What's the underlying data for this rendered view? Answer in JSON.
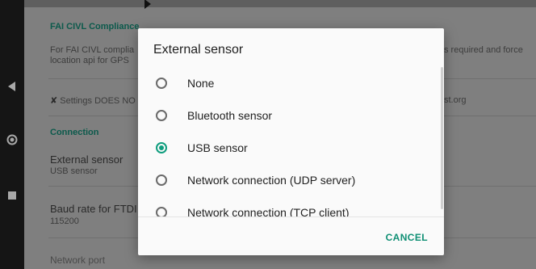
{
  "background": {
    "sections": [
      {
        "header": "FAI CIVL Compliance",
        "desc_left": "For FAI CIVL complia",
        "desc_left2": "location api for GPS",
        "desc_right": "s required and force",
        "warning_left": "Settings DOES NO",
        "warning_right": "st.org"
      }
    ],
    "connection_header": "Connection",
    "external_sensor_title": "External sensor",
    "external_sensor_value": "USB sensor",
    "baud_title": "Baud rate for FTDI",
    "baud_value": "115200",
    "network_port": "Network port"
  },
  "dialog": {
    "title": "External sensor",
    "options": [
      {
        "label": "None",
        "selected": false
      },
      {
        "label": "Bluetooth sensor",
        "selected": false
      },
      {
        "label": "USB sensor",
        "selected": true
      },
      {
        "label": "Network connection (UDP server)",
        "selected": false
      },
      {
        "label": "Network connection (TCP client)",
        "selected": false
      }
    ],
    "cancel_label": "CANCEL"
  },
  "navbar": {
    "back_icon": "back-triangle-icon",
    "home_icon": "home-circle-icon",
    "recents_icon": "recents-square-icon"
  },
  "colors": {
    "accent": "#0f9d7e",
    "section_header": "#0c5a4c"
  }
}
